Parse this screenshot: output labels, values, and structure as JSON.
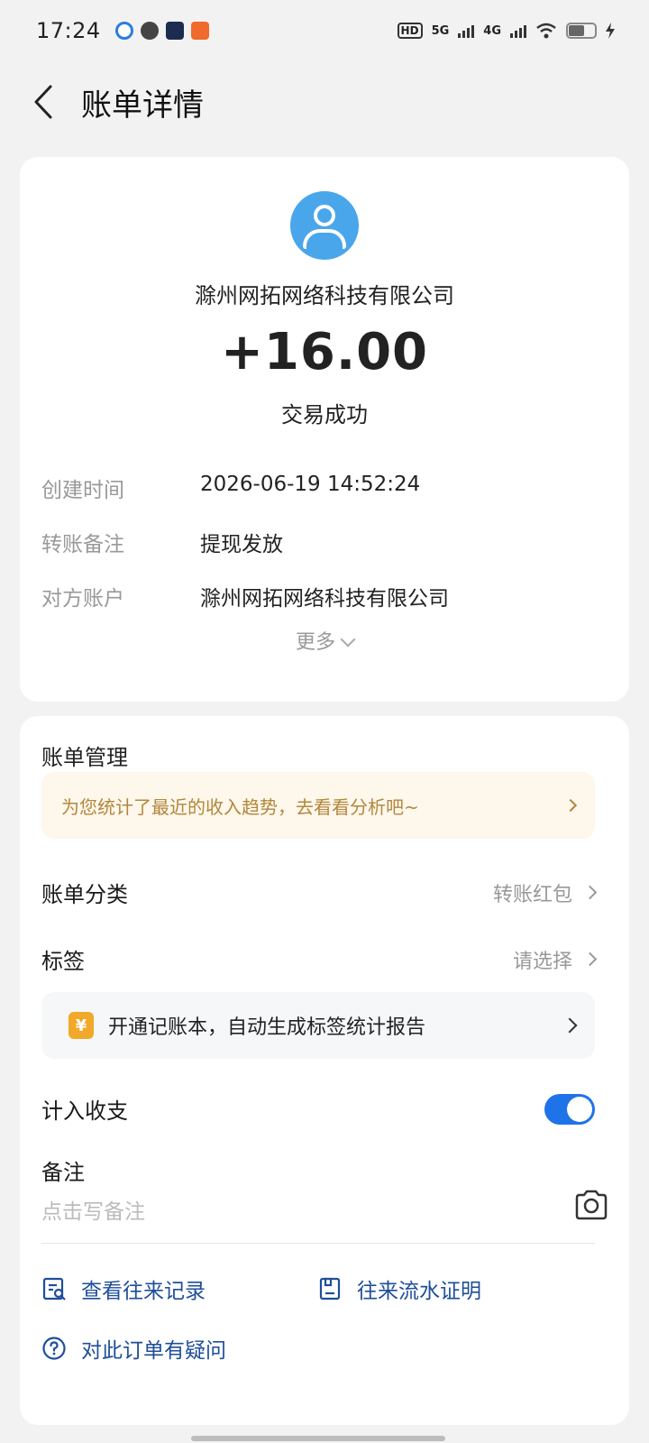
{
  "status_bar": {
    "time": "17:24",
    "hd": "HD",
    "network1": "5G",
    "network2": "4G"
  },
  "header": {
    "title": "账单详情"
  },
  "transaction": {
    "counterparty": "滁州网拓网络科技有限公司",
    "amount": "+16.00",
    "status": "交易成功",
    "details": [
      {
        "label": "创建时间",
        "value": "2026-06-19 14:52:24"
      },
      {
        "label": "转账备注",
        "value": "提现发放"
      },
      {
        "label": "对方账户",
        "value": "滁州网拓网络科技有限公司"
      }
    ],
    "more_label": "更多"
  },
  "management": {
    "title": "账单管理",
    "promo_text": "为您统计了最近的收入趋势，去看看分析吧~",
    "category_label": "账单分类",
    "category_value": "转账红包",
    "tag_label": "标签",
    "tag_value": "请选择",
    "ledger_icon": "¥",
    "ledger_text": "开通记账本，自动生成标签统计报告",
    "include_label": "计入收支",
    "include_enabled": true,
    "memo_label": "备注",
    "memo_placeholder": "点击写备注"
  },
  "actions": {
    "history": "查看往来记录",
    "proof": "往来流水证明",
    "question": "对此订单有疑问"
  },
  "colors": {
    "accent": "#1f73e8",
    "avatar": "#4aa6ea",
    "promo_text": "#b3873a",
    "action_text": "#1f4e99"
  }
}
